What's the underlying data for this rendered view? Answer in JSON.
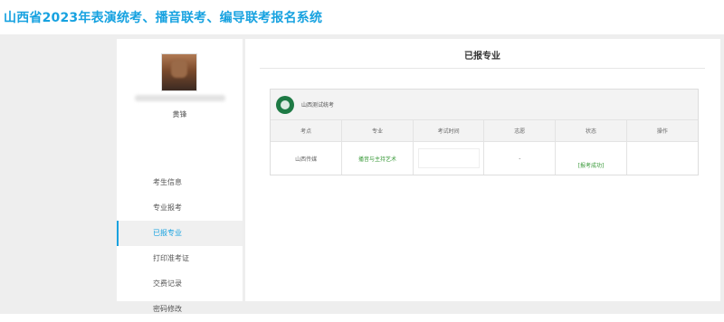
{
  "header": {
    "title": "山西省2023年表演统考、播音联考、编导联考报名系统"
  },
  "sidebar": {
    "user_name": "黄锋",
    "items": [
      {
        "label": "考生信息"
      },
      {
        "label": "专业报考"
      },
      {
        "label": "已报专业"
      },
      {
        "label": "打印准考证"
      },
      {
        "label": "交费记录"
      },
      {
        "label": "密码修改"
      }
    ],
    "active_index": 2
  },
  "main": {
    "title": "已报专业",
    "exam": {
      "name": "山西测试统考",
      "columns": [
        "考点",
        "专业",
        "考试时间",
        "志愿",
        "状态",
        "操作"
      ],
      "rows": [
        {
          "location": "山西传媒",
          "major": "播音与主持艺术",
          "exam_time": "",
          "preference": "-",
          "status": "[报考成功]",
          "action": ""
        }
      ]
    }
  },
  "colors": {
    "accent": "#17a2e0",
    "success": "#3a9a3a",
    "background": "#eeeeee"
  }
}
